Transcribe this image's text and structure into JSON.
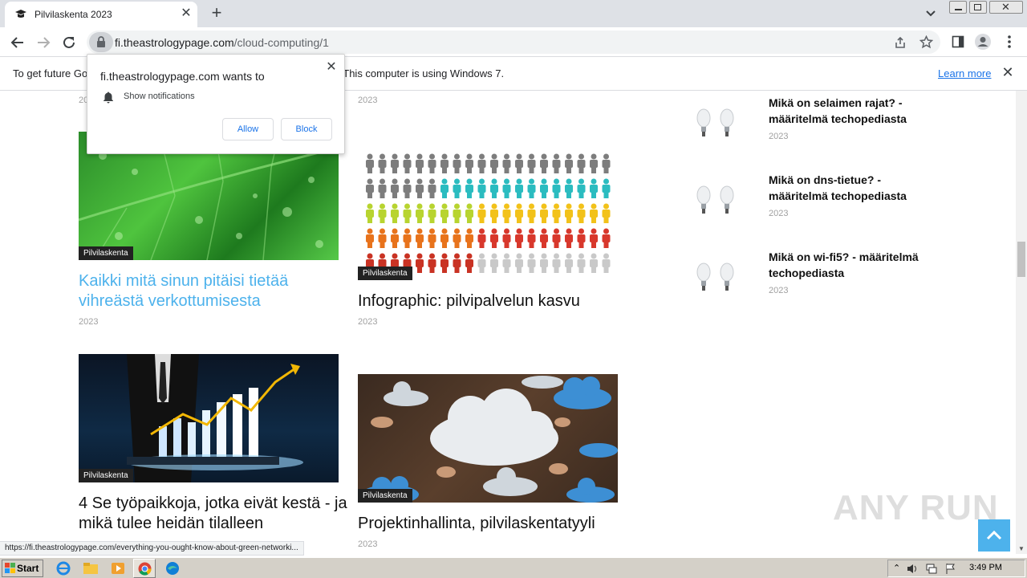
{
  "browser": {
    "tab_title": "Pilvilaskenta 2023",
    "url_host": "fi.theastrologypage.com",
    "url_path": "/cloud-computing/1"
  },
  "infobar": {
    "message": "To get future Google Chrome updates, you'll need Windows 10 or later. This computer is using Windows 7.",
    "learn_more": "Learn more"
  },
  "popup": {
    "title": "fi.theastrologypage.com wants to",
    "permission": "Show notifications",
    "allow": "Allow",
    "block": "Block"
  },
  "articles": [
    {
      "date_above": "2023",
      "badge": "Pilvilaskenta",
      "title": "Kaikki mitä sinun pitäisi tietää vihreästä verkottumisesta",
      "date": "2023"
    },
    {
      "date_above": "2023",
      "badge": "Pilvilaskenta",
      "title": "Infographic: pilvipalvelun kasvu",
      "date": "2023"
    },
    {
      "badge": "Pilvilaskenta",
      "title": "4 Se työpaikkoja, jotka eivät kestä - ja mikä tulee heidän tilalleen"
    },
    {
      "badge": "Pilvilaskenta",
      "title": "Projektinhallinta, pilvilaskentatyyli",
      "date": "2023"
    }
  ],
  "sidebar": [
    {
      "title": "Mikä on selaimen rajat? - määritelmä techopediasta",
      "date": "2023"
    },
    {
      "title": "Mikä on dns-tietue? - määritelmä techopediasta",
      "date": "2023"
    },
    {
      "title": "Mikä on wi-fi5? - määritelmä techopediasta",
      "date": "2023"
    }
  ],
  "status_url": "https://fi.theastrologypage.com/everything-you-ought-know-about-green-networki...",
  "watermark": "ANY RUN",
  "taskbar": {
    "start": "Start",
    "clock": "3:49 PM"
  }
}
